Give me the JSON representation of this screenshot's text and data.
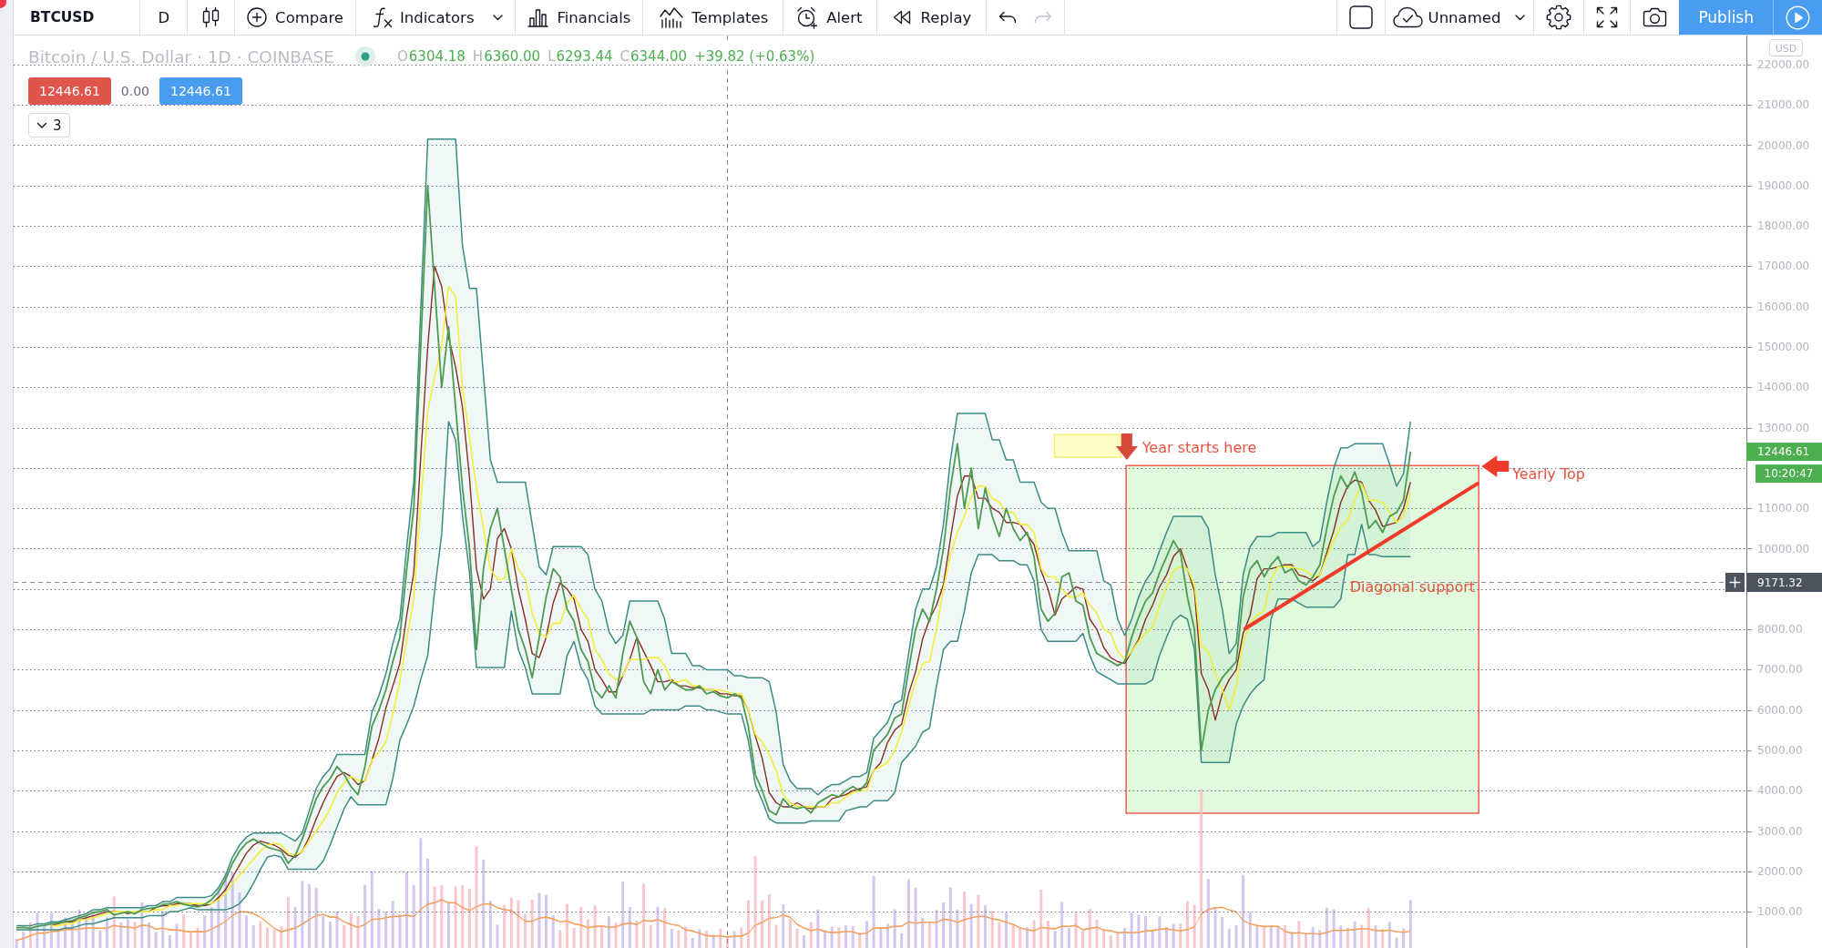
{
  "toolbar": {
    "symbol": "BTCUSD",
    "interval": "D",
    "tools": [
      {
        "kind": "chart_type"
      },
      {
        "kind": "compare",
        "label": "Compare"
      },
      {
        "kind": "indicators",
        "label": "Indicators"
      },
      {
        "kind": "favorites"
      },
      {
        "kind": "financials",
        "label": "Financials"
      },
      {
        "kind": "templates",
        "label": "Templates"
      },
      {
        "kind": "alert",
        "label": "Alert"
      },
      {
        "kind": "replay",
        "label": "Replay"
      }
    ],
    "history": [
      {
        "kind": "undo",
        "disabled": false
      },
      {
        "kind": "redo",
        "disabled": true
      }
    ],
    "layout_tools": [
      {
        "kind": "layout"
      },
      {
        "kind": "layout_name",
        "label": "Unnamed"
      },
      {
        "kind": "settings"
      },
      {
        "kind": "fullscreen"
      },
      {
        "kind": "snapshot"
      }
    ],
    "actions": [
      {
        "kind": "publish",
        "label": "Publish"
      },
      {
        "kind": "stream"
      }
    ]
  },
  "legend": {
    "title": "Bitcoin / U.S. Dollar · 1D · COINBASE",
    "market_open": true,
    "ohlc": [
      {
        "label": "O",
        "value": "6304.18"
      },
      {
        "label": "H",
        "value": "6360.00"
      },
      {
        "label": "L",
        "value": "6293.44"
      },
      {
        "label": "C",
        "value": "6344.00"
      }
    ],
    "change": "+39.82 (+0.63%)",
    "rising": true
  },
  "order_panel": {
    "sell_price": "12446.61",
    "spread": "0.00",
    "buy_price": "12446.61"
  },
  "indicator_toggle": {
    "expanded": false,
    "count": "3"
  },
  "chart": {
    "currency": "USD",
    "last_price": "12446.61",
    "countdown": "10:20:47",
    "crosshair_price": "9171.32",
    "chart_data": {
      "type": "line",
      "ylim": [
        100,
        22720
      ],
      "grid": true,
      "yticks": [
        {
          "value": 1000,
          "label": "1000.00"
        },
        {
          "value": 2000,
          "label": "2000.00"
        },
        {
          "value": 3000,
          "label": "3000.00"
        },
        {
          "value": 4000,
          "label": "4000.00"
        },
        {
          "value": 5000,
          "label": "5000.00"
        },
        {
          "value": 6000,
          "label": "6000.00"
        },
        {
          "value": 7000,
          "label": "7000.00"
        },
        {
          "value": 8000,
          "label": "8000.00"
        },
        {
          "value": 10000,
          "label": "10000.00"
        },
        {
          "value": 11000,
          "label": "11000.00"
        },
        {
          "value": 13000,
          "label": "13000.00"
        },
        {
          "value": 14000,
          "label": "14000.00"
        },
        {
          "value": 15000,
          "label": "15000.00"
        },
        {
          "value": 16000,
          "label": "16000.00"
        },
        {
          "value": 17000,
          "label": "17000.00"
        },
        {
          "value": 18000,
          "label": "18000.00"
        },
        {
          "value": 19000,
          "label": "19000.00"
        },
        {
          "value": 20000,
          "label": "20000.00"
        },
        {
          "value": 21000,
          "label": "21000.00"
        },
        {
          "value": 22000,
          "label": "22000.00"
        }
      ],
      "series": [
        {
          "color": "#4e9a52",
          "values": [
            600,
            610,
            590,
            640,
            660,
            700,
            720,
            760,
            780,
            850,
            900,
            980,
            1000,
            1050,
            920,
            960,
            1000,
            950,
            1050,
            1080,
            1100,
            1180,
            1200,
            1250,
            1180,
            1150,
            1120,
            1180,
            1300,
            1500,
            1800,
            2200,
            2500,
            2700,
            2800,
            2700,
            2600,
            2550,
            2500,
            2200,
            2400,
            2800,
            3300,
            3800,
            4100,
            4300,
            4600,
            4400,
            4100,
            3900,
            4600,
            5600,
            6000,
            6500,
            7200,
            7800,
            9500,
            11000,
            15000,
            19000,
            16500,
            14000,
            15500,
            13500,
            11500,
            10000,
            7500,
            9500,
            10500,
            11000,
            10000,
            9000,
            8000,
            7500,
            6800,
            7800,
            8800,
            9500,
            9300,
            8500,
            8200,
            7500,
            7200,
            6500,
            6300,
            6600,
            6300,
            7400,
            8200,
            7800,
            6700,
            6400,
            7000,
            6500,
            6700,
            6600,
            6500,
            6500,
            6600,
            6400,
            6450,
            6350,
            6300,
            6400,
            6300,
            5600,
            4400,
            4000,
            3500,
            3400,
            3800,
            3600,
            3550,
            3600,
            3450,
            3700,
            3800,
            3900,
            3850,
            4000,
            4100,
            4000,
            4200,
            5000,
            5200,
            5400,
            5800,
            5900,
            7000,
            8000,
            8500,
            8200,
            9000,
            10000,
            11500,
            12600,
            11000,
            12000,
            10500,
            11500,
            10800,
            10300,
            11000,
            10500,
            10200,
            10400,
            9800,
            8500,
            8200,
            8400,
            9300,
            9400,
            8700,
            8600,
            7800,
            7400,
            7300,
            7200,
            7100,
            7200,
            7800,
            8300,
            8700,
            8900,
            9400,
            9800,
            10200,
            9900,
            8800,
            8000,
            5000,
            6000,
            6500,
            6800,
            7000,
            7200,
            8800,
            9500,
            9700,
            9300,
            9600,
            9800,
            9400,
            9500,
            9200,
            9100,
            9300,
            9600,
            10500,
            11300,
            11800,
            11500,
            11900,
            11400,
            10500,
            10700,
            10400,
            10800,
            10900,
            11200,
            12400
          ]
        },
        {
          "color": "#3b8c85",
          "values": [
            650,
            650,
            650,
            700,
            700,
            750,
            750,
            800,
            850,
            900,
            950,
            1050,
            1050,
            1100,
            1100,
            1100,
            1100,
            1100,
            1100,
            1150,
            1150,
            1250,
            1250,
            1350,
            1350,
            1350,
            1350,
            1350,
            1400,
            1600,
            1900,
            2350,
            2650,
            2850,
            2950,
            2950,
            2950,
            2950,
            2950,
            2850,
            2750,
            2950,
            3500,
            4050,
            4350,
            4550,
            4900,
            4900,
            4900,
            4900,
            4900,
            5950,
            6350,
            6900,
            7650,
            8250,
            10050,
            11650,
            15900,
            20150,
            20150,
            20150,
            20150,
            20150,
            17500,
            16450,
            16450,
            14300,
            12200,
            11650,
            11650,
            11650,
            11650,
            11650,
            10600,
            9550,
            9350,
            10050,
            10050,
            10050,
            10050,
            10050,
            9850,
            9000,
            8700,
            7950,
            7650,
            7850,
            8700,
            8700,
            8700,
            8700,
            8700,
            8250,
            7400,
            7400,
            7400,
            7100,
            7100,
            7000,
            7000,
            7000,
            7000,
            6850,
            6850,
            6800,
            6800,
            6800,
            6700,
            5950,
            4650,
            4250,
            4050,
            4050,
            4050,
            3900,
            4050,
            4150,
            4150,
            4250,
            4350,
            4350,
            4450,
            5300,
            5500,
            5700,
            6150,
            6250,
            7400,
            8500,
            9000,
            9000,
            9550,
            10600,
            12200,
            13350,
            13350,
            13350,
            13350,
            13350,
            12700,
            12700,
            12200,
            12200,
            11650,
            11650,
            11650,
            11150,
            11000,
            11000,
            10400,
            9950,
            9950,
            9950,
            9950,
            9950,
            9200,
            9100,
            8250,
            7850,
            8250,
            8800,
            9200,
            9450,
            9950,
            10400,
            10800,
            10800,
            10800,
            10800,
            10800,
            10500,
            9350,
            8500,
            7400,
            7650,
            9350,
            10050,
            10300,
            10300,
            10300,
            10400,
            10400,
            10400,
            10400,
            10400,
            10050,
            10200,
            11150,
            12000,
            12500,
            12500,
            12600,
            12600,
            12600,
            12600,
            12600,
            12100,
            11550,
            11850,
            13150
          ]
        },
        {
          "color": "#3b8c85",
          "values": [
            550,
            550,
            550,
            550,
            550,
            550,
            550,
            600,
            600,
            650,
            700,
            700,
            750,
            800,
            850,
            850,
            850,
            850,
            850,
            900,
            900,
            900,
            1000,
            1000,
            1050,
            1100,
            1050,
            1050,
            1050,
            1050,
            1050,
            1100,
            1200,
            1400,
            1700,
            2050,
            2350,
            2400,
            2350,
            2050,
            2050,
            2050,
            2050,
            2050,
            2250,
            2650,
            3100,
            3550,
            3850,
            3650,
            3650,
            3650,
            3650,
            3650,
            4300,
            5250,
            5650,
            6100,
            6750,
            7350,
            8950,
            10350,
            13150,
            12700,
            10800,
            9400,
            7050,
            7050,
            7050,
            7050,
            7050,
            8450,
            7500,
            7050,
            6400,
            6400,
            6400,
            6400,
            6400,
            7350,
            7700,
            7050,
            6750,
            6100,
            5900,
            5900,
            5900,
            5900,
            5900,
            5900,
            5900,
            6000,
            6000,
            6000,
            6000,
            6000,
            6100,
            6100,
            6100,
            6000,
            6000,
            5950,
            5900,
            5900,
            5900,
            5250,
            4150,
            3750,
            3300,
            3200,
            3200,
            3200,
            3200,
            3200,
            3250,
            3250,
            3250,
            3250,
            3250,
            3500,
            3550,
            3600,
            3600,
            3750,
            3750,
            3750,
            3950,
            4700,
            4900,
            5100,
            5450,
            5550,
            6600,
            7500,
            7700,
            7700,
            8450,
            9400,
            9850,
            9850,
            9850,
            9700,
            9700,
            9700,
            9600,
            9600,
            9200,
            8000,
            7700,
            7700,
            7700,
            7700,
            7700,
            7900,
            7350,
            6950,
            6850,
            6750,
            6650,
            6650,
            6650,
            6650,
            6650,
            6750,
            7350,
            7800,
            8200,
            8350,
            8250,
            7500,
            4700,
            4700,
            4700,
            4700,
            4700,
            5650,
            6100,
            6400,
            6600,
            6750,
            8250,
            8750,
            8750,
            8750,
            8650,
            8550,
            8550,
            8550,
            8550,
            8550,
            8750,
            9850,
            9850,
            10600,
            9850,
            9850,
            9800,
            9800,
            9800,
            9800,
            9800
          ]
        },
        {
          "color": "#f2ee3a",
          "values": [
            null,
            null,
            null,
            null,
            null,
            650,
            650,
            700,
            700,
            800,
            800,
            850,
            900,
            950,
            1000,
            1000,
            1000,
            1000,
            1000,
            1000,
            1050,
            1050,
            1150,
            1150,
            1200,
            1200,
            1200,
            1200,
            1200,
            1300,
            1450,
            1700,
            1900,
            2100,
            2300,
            2500,
            2650,
            2700,
            2650,
            2450,
            2400,
            2500,
            2750,
            3000,
            3250,
            3550,
            3950,
            4200,
            4350,
            4250,
            4250,
            4750,
            4950,
            5200,
            5900,
            6700,
            7750,
            8750,
            11100,
            13400,
            14250,
            15000,
            16500,
            16250,
            14000,
            12750,
            11500,
            10500,
            9500,
            9250,
            9250,
            10000,
            9500,
            9250,
            8400,
            7900,
            7800,
            8150,
            8150,
            8650,
            8850,
            8500,
            8250,
            7500,
            7250,
            6900,
            6750,
            6850,
            7250,
            7250,
            7250,
            7300,
            7300,
            7100,
            6700,
            6700,
            6750,
            6600,
            6600,
            6500,
            6500,
            6500,
            6450,
            6400,
            6400,
            6000,
            5400,
            5200,
            4900,
            4500,
            3900,
            3700,
            3600,
            3600,
            3600,
            3600,
            3600,
            3700,
            3700,
            3850,
            3950,
            4000,
            4000,
            4500,
            4600,
            4700,
            5000,
            5450,
            6100,
            6700,
            7150,
            7200,
            8000,
            9000,
            9850,
            10400,
            10800,
            11300,
            11550,
            11550,
            11250,
            11150,
            10900,
            10900,
            10600,
            10600,
            10400,
            9500,
            9300,
            9300,
            9000,
            8800,
            8800,
            8900,
            8600,
            8400,
            8000,
            7900,
            7450,
            7250,
            7450,
            7700,
            7900,
            8050,
            8600,
            9050,
            9450,
            9550,
            9500,
            9100,
            7600,
            7450,
            6900,
            6500,
            6000,
            6600,
            7650,
            8150,
            8350,
            8450,
            9250,
            9550,
            9550,
            9550,
            9500,
            9450,
            9300,
            9350,
            9800,
            10200,
            10550,
            10700,
            11200,
            11600,
            11200,
            11200,
            11150,
            10900,
            10650,
            10800,
            11400
          ]
        },
        {
          "color": "#8b2e22",
          "values": [
            null,
            null,
            null,
            null,
            null,
            650,
            700,
            750,
            750,
            800,
            850,
            900,
            950,
            1000,
            1000,
            1000,
            950,
            1000,
            1000,
            1000,
            1100,
            1150,
            1150,
            1200,
            1200,
            1200,
            1150,
            1150,
            1200,
            1350,
            1550,
            1850,
            2150,
            2450,
            2650,
            2750,
            2700,
            2650,
            2550,
            2400,
            2350,
            2500,
            2850,
            3300,
            3700,
            4050,
            4350,
            4450,
            4350,
            4150,
            4250,
            4750,
            5300,
            6050,
            6600,
            7150,
            8350,
            9400,
            12250,
            15000,
            17000,
            16500,
            15250,
            14500,
            13500,
            11750,
            9500,
            8750,
            9000,
            10250,
            10500,
            10000,
            9000,
            8250,
            7400,
            7300,
            7800,
            8650,
            9150,
            9000,
            8750,
            8000,
            7700,
            7000,
            6750,
            6450,
            6450,
            6850,
            7250,
            7800,
            7450,
            7100,
            6700,
            6700,
            6750,
            6600,
            6600,
            6550,
            6550,
            6500,
            6500,
            6400,
            6400,
            6350,
            6350,
            6000,
            5350,
            4800,
            3950,
            3700,
            3600,
            3600,
            3700,
            3600,
            3550,
            3600,
            3600,
            3800,
            3850,
            3900,
            4000,
            4050,
            4100,
            4500,
            4700,
            5200,
            5500,
            5650,
            6400,
            6950,
            7750,
            8250,
            8600,
            9100,
            10250,
            11300,
            11800,
            11800,
            11250,
            11250,
            11000,
            10900,
            10650,
            10650,
            10600,
            10350,
            10100,
            9450,
            9000,
            8350,
            8750,
            8900,
            9050,
            9000,
            8250,
            8000,
            7550,
            7300,
            7200,
            7150,
            7450,
            7750,
            8250,
            8600,
            9050,
            9350,
            9800,
            10000,
            9500,
            8950,
            6900,
            6500,
            5750,
            6400,
            6750,
            7000,
            7900,
            8350,
            9250,
            9500,
            9500,
            9550,
            9600,
            9600,
            9350,
            9300,
            9200,
            9350,
            9900,
            10450,
            11150,
            11550,
            11700,
            11650,
            11200,
            10950,
            10550,
            10600,
            10650,
            11000,
            11650
          ]
        }
      ]
    },
    "drawings": [
      {
        "kind": "range_box"
      },
      {
        "kind": "highlight_box"
      },
      {
        "kind": "trend_line"
      },
      {
        "kind": "arrow_down"
      },
      {
        "kind": "label",
        "text": "Year starts here"
      },
      {
        "kind": "arrow_left"
      },
      {
        "kind": "label",
        "text": "Yearly Top"
      },
      {
        "kind": "label",
        "text": "Diagonal support"
      }
    ]
  }
}
